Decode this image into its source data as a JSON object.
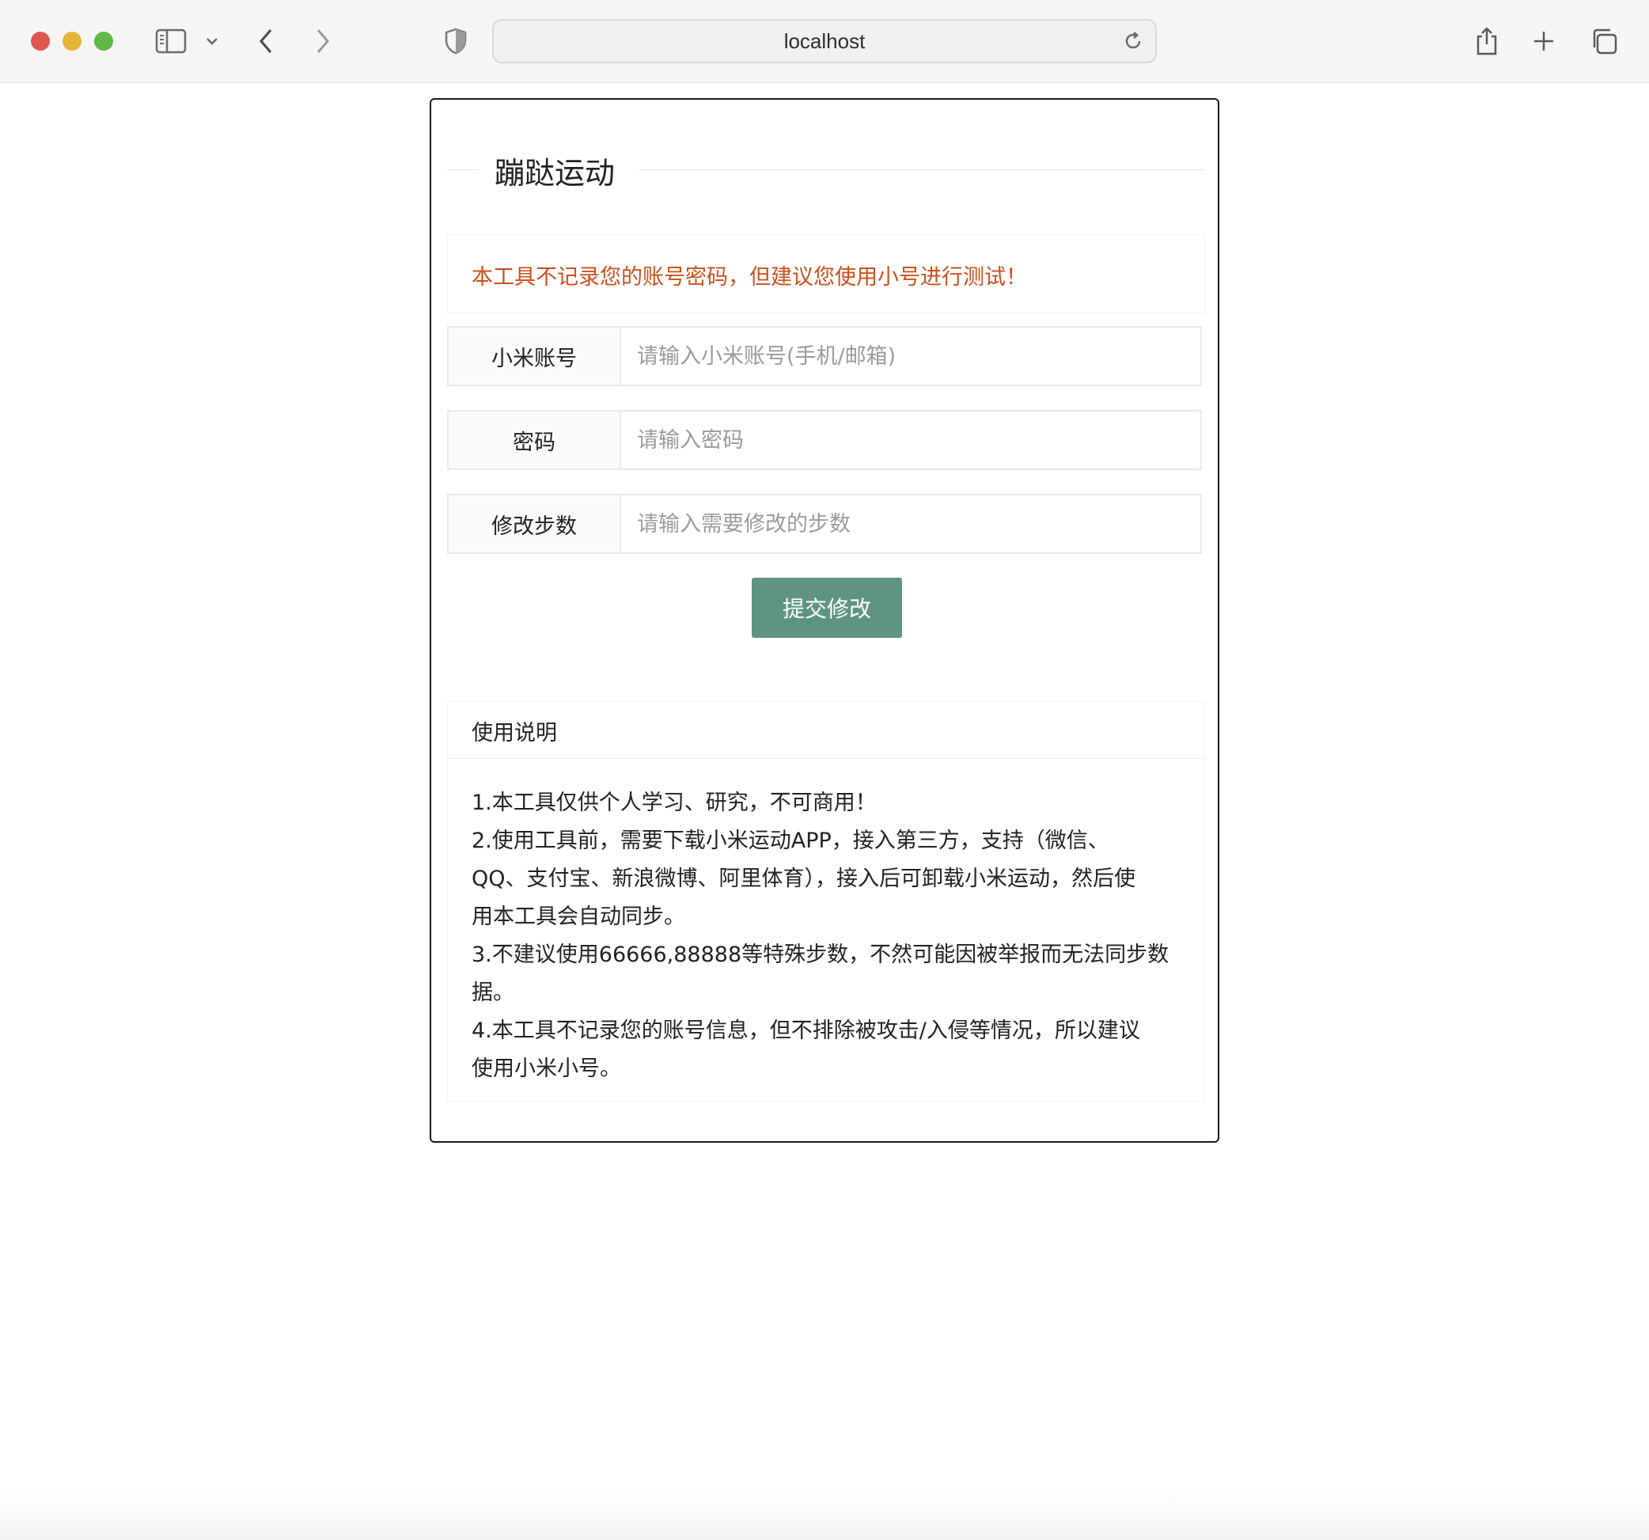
{
  "browser": {
    "url": "localhost",
    "icons": {
      "sidebar": "sidebar-icon",
      "chevron": "chevron-down-icon",
      "back": "back-arrow-icon",
      "forward": "forward-arrow-icon",
      "shield": "shield-icon",
      "reload": "reload-icon",
      "share": "share-icon",
      "new_tab": "plus-icon",
      "tabs": "tabs-overview-icon"
    },
    "traffic_colors": [
      "#e0584e",
      "#e6b43a",
      "#5fb849"
    ]
  },
  "card": {
    "title": "蹦跶运动",
    "notice": "本工具不记录您的账号密码，但建议您使用小号进行测试！",
    "form": {
      "account_label": "小米账号",
      "account_placeholder": "请输入小米账号(手机/邮箱)",
      "password_label": "密码",
      "password_placeholder": "请输入密码",
      "steps_label": "修改步数",
      "steps_placeholder": "请输入需要修改的步数",
      "submit_label": "提交修改"
    },
    "help": {
      "title": "使用说明",
      "lines": [
        "1.本工具仅供个人学习、研究，不可商用！",
        "2.使用工具前，需要下载小米运动APP，接入第三方，支持（微信、",
        "QQ、支付宝、新浪微博、阿里体育），接入后可卸载小米运动，然后使",
        "用本工具会自动同步。",
        "3.不建议使用66666,88888等特殊步数，不然可能因被举报而无法同步数",
        "据。",
        "4.本工具不记录您的账号信息，但不排除被攻击/入侵等情况，所以建议",
        "使用小米小号。"
      ]
    }
  },
  "colors": {
    "notice": "#c9501c",
    "button": "#5f9485"
  }
}
